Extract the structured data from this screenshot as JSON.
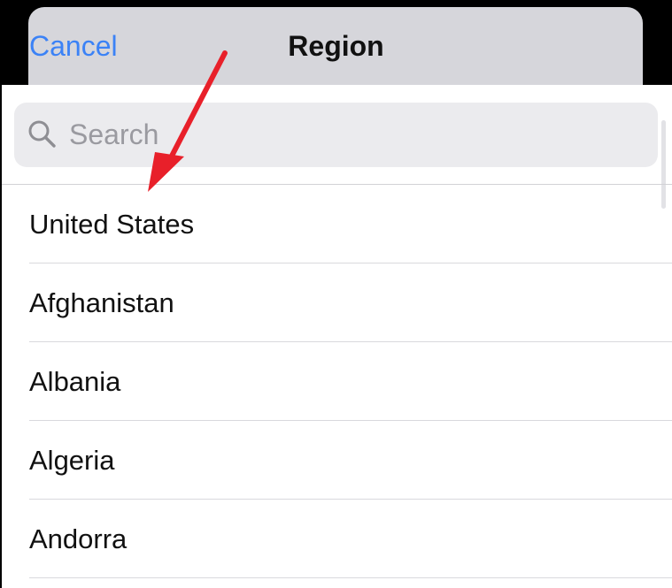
{
  "nav": {
    "cancel_label": "Cancel",
    "title": "Region"
  },
  "search": {
    "placeholder": "Search",
    "icon": "search-icon"
  },
  "regions": [
    {
      "label": "United States"
    },
    {
      "label": "Afghanistan"
    },
    {
      "label": "Albania"
    },
    {
      "label": "Algeria"
    },
    {
      "label": "Andorra"
    }
  ],
  "colors": {
    "accent": "#3b82f6",
    "annotation": "#e8202a",
    "sheet_background": "#d6d6db",
    "list_background": "#ffffff"
  }
}
